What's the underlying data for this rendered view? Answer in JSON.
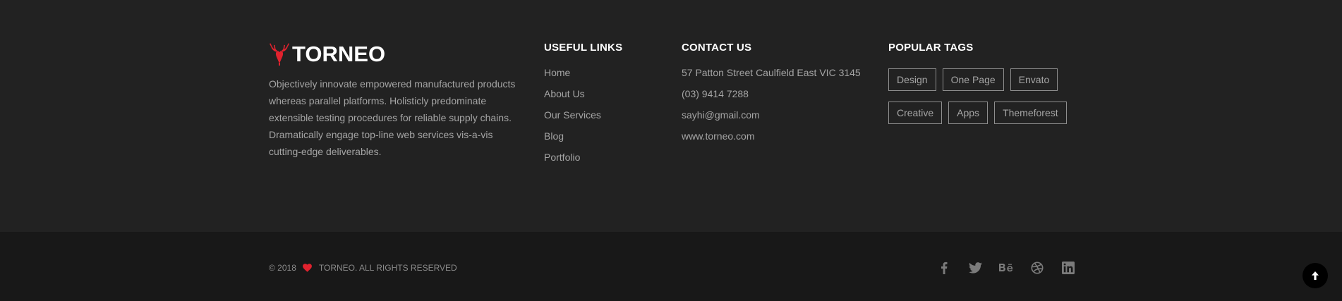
{
  "brand": {
    "name": "TORNEO",
    "accent_color": "#e1222e"
  },
  "about": {
    "text": "Objectively innovate empowered manufactured products whereas parallel platforms. Holisticly predominate extensible testing procedures for reliable supply chains. Dramatically engage top-line web services vis-a-vis cutting-edge deliverables."
  },
  "useful_links": {
    "title": "USEFUL LINKS",
    "items": [
      "Home",
      "About Us",
      "Our Services",
      "Blog",
      "Portfolio"
    ]
  },
  "contact": {
    "title": "CONTACT US",
    "address": "57 Patton Street Caulfield East VIC 3145",
    "phone": "(03) 9414 7288",
    "email": "sayhi@gmail.com",
    "website": "www.torneo.com"
  },
  "tags": {
    "title": "POPULAR TAGS",
    "items": [
      "Design",
      "One Page",
      "Envato",
      "Creative",
      "Apps",
      "Themeforest"
    ]
  },
  "footer": {
    "year": "© 2018",
    "rights": "TORNEO. ALL RIGHTS RESERVED",
    "socials": [
      "facebook-icon",
      "twitter-icon",
      "behance-icon",
      "dribbble-icon",
      "linkedin-icon"
    ]
  },
  "colors": {
    "top_bg": "#222222",
    "bottom_bg": "#181818",
    "text_muted": "#a5a5a5",
    "heart": "#e1222e"
  }
}
